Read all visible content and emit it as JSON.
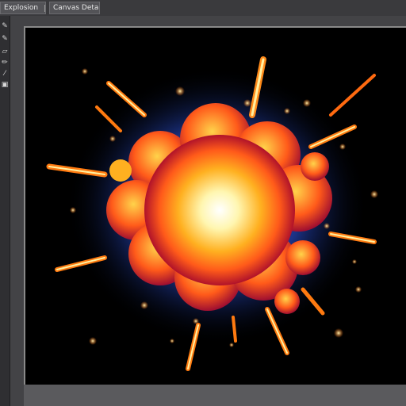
{
  "tabs": [
    {
      "label": "Explosion"
    },
    {
      "label": "Canvas Detail"
    }
  ],
  "toolbar": {
    "tools": [
      "brush-icon",
      "pen-icon",
      "eraser-icon",
      "pencil-icon",
      "wand-icon",
      "image-icon"
    ]
  },
  "canvas": {
    "background": "#000000",
    "accent_colors": [
      "#fff6b0",
      "#ffb020",
      "#ff5a1a",
      "#b0122a",
      "#3d6bff"
    ]
  }
}
